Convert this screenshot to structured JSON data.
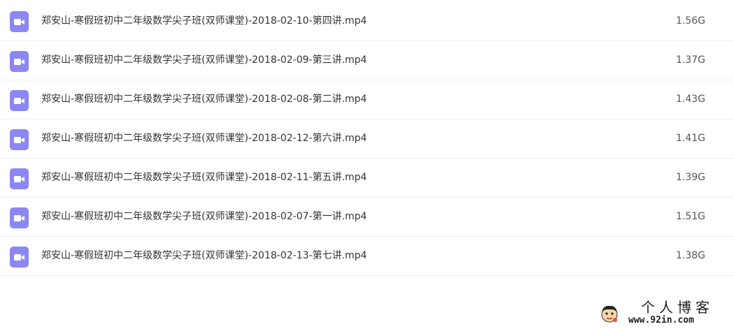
{
  "files": [
    {
      "name": "郑安山-寒假班初中二年级数学尖子班(双师课堂)-2018-02-10-第四讲.mp4",
      "size": "1.56G",
      "icon": "video-file-icon"
    },
    {
      "name": "郑安山-寒假班初中二年级数学尖子班(双师课堂)-2018-02-09-第三讲.mp4",
      "size": "1.37G",
      "icon": "video-file-icon"
    },
    {
      "name": "郑安山-寒假班初中二年级数学尖子班(双师课堂)-2018-02-08-第二讲.mp4",
      "size": "1.43G",
      "icon": "video-file-icon"
    },
    {
      "name": "郑安山-寒假班初中二年级数学尖子班(双师课堂)-2018-02-12-第六讲.mp4",
      "size": "1.41G",
      "icon": "video-file-icon"
    },
    {
      "name": "郑安山-寒假班初中二年级数学尖子班(双师课堂)-2018-02-11-第五讲.mp4",
      "size": "1.39G",
      "icon": "video-file-icon"
    },
    {
      "name": "郑安山-寒假班初中二年级数学尖子班(双师课堂)-2018-02-07-第一讲.mp4",
      "size": "1.51G",
      "icon": "video-file-icon"
    },
    {
      "name": "郑安山-寒假班初中二年级数学尖子班(双师课堂)-2018-02-13-第七讲.mp4",
      "size": "1.38G",
      "icon": "video-file-icon"
    }
  ],
  "watermark": {
    "title": "个人博客",
    "url": "www.92in.com"
  },
  "colors": {
    "icon_bg": "#8b87f5",
    "row_divider": "#eeeeee"
  }
}
